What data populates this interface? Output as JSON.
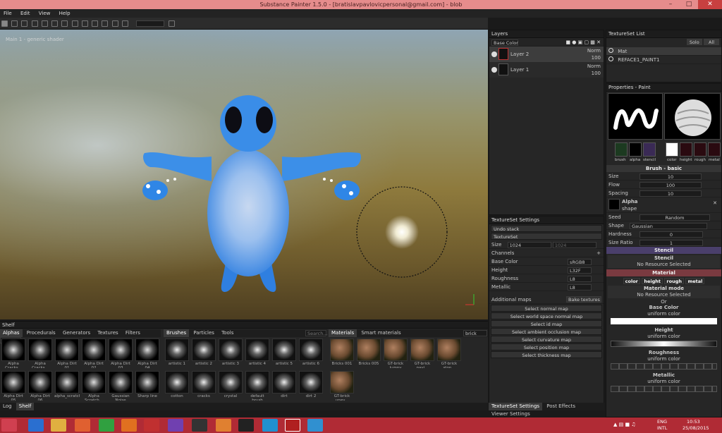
{
  "window": {
    "title": "Substance Painter 1.5.0 - [bratislavpavlovicpersonal@gmail.com] - blob"
  },
  "menu": [
    "File",
    "Edit",
    "View",
    "Help"
  ],
  "viewport": {
    "label": "Main 1 - generic shader"
  },
  "layers": {
    "title": "Layers",
    "channel": "Base Color",
    "items": [
      {
        "name": "Layer 2",
        "blend": "Norm",
        "opacity": "100"
      },
      {
        "name": "Layer 1",
        "blend": "Norm",
        "opacity": "100"
      }
    ]
  },
  "textureset_list": {
    "title": "TextureSet List",
    "solo": "Solo",
    "all": "All",
    "items": [
      "Mat",
      "REFACE1_PAINT1"
    ]
  },
  "properties": {
    "title": "Properties - Paint",
    "slots": [
      "brush",
      "alpha",
      "stencil",
      "color",
      "height",
      "rough",
      "metal"
    ],
    "brush_section": "Brush - basic",
    "size_label": "Size",
    "size_value": "10",
    "flow_label": "Flow",
    "flow_value": "100",
    "spacing_label": "Spacing",
    "spacing_value": "10",
    "alpha_label": "Alpha",
    "alpha_sub": "shape",
    "seed_label": "Seed",
    "seed_value": "Random",
    "shape_label": "Shape",
    "shape_value": "Gaussian",
    "hardness_label": "Hardness",
    "hardness_value": "0",
    "ratio_label": "Size Ratio",
    "ratio_value": "1",
    "stencil_section": "Stencil",
    "stencil_title": "Stencil",
    "stencil_none": "No Resource Selected",
    "material_section": "Material",
    "material_channels": [
      "color",
      "height",
      "rough",
      "metal"
    ],
    "material_mode": "Material mode",
    "material_none": "No Resource Selected",
    "material_or": "Or",
    "basecolor_label": "Base Color",
    "basecolor_sub": "uniform color",
    "height_label": "Height",
    "height_sub": "uniform color",
    "roughness_label": "Roughness",
    "roughness_sub": "uniform color",
    "metallic_label": "Metallic",
    "metallic_sub": "uniform color"
  },
  "textureset_settings": {
    "title": "TextureSet Settings",
    "undo": "Undo stack",
    "textureset": "TextureSet",
    "size_label": "Size",
    "size_value": "1024",
    "size_value2": "1024",
    "channels_label": "Channels",
    "channels": [
      {
        "name": "Base Color",
        "format": "sRGB8"
      },
      {
        "name": "Height",
        "format": "L32F"
      },
      {
        "name": "Roughness",
        "format": "L8"
      },
      {
        "name": "Metallic",
        "format": "L8"
      }
    ],
    "additional_maps": "Additional maps",
    "bake_button": "Bake textures",
    "maps": [
      "Select normal map",
      "Select world space normal map",
      "Select id map",
      "Select ambient occlusion map",
      "Select curvature map",
      "Select position map",
      "Select thickness map"
    ],
    "bottom_tabs": [
      "TextureSet Settings",
      "Post Effects",
      "Viewer Settings"
    ]
  },
  "shelf": {
    "title": "Shelf",
    "tabs": [
      "Alphas",
      "Procedurals",
      "Generators",
      "Textures",
      "Filters"
    ],
    "search_placeholder": "Search...",
    "alphas": [
      "Alpha Cracks...",
      "Alpha Cracks...",
      "Alpha Dirt 01",
      "Alpha Dirt 02",
      "Alpha Dirt 03",
      "Alpha Dirt 04",
      "Alpha Dirt 05",
      "Alpha Dirt 06",
      "alpha_scratch...",
      "Alpha Scratch...",
      "Gaussian Noise",
      "Sharp line"
    ],
    "brush_tabs": [
      "Brushes",
      "Particles",
      "Tools"
    ],
    "brushes": [
      "artistic 1",
      "artistic 2",
      "artistic 3",
      "artistic 4",
      "artistic 5",
      "artistic 6",
      "cotton",
      "cracks",
      "crystal",
      "default brush",
      "dirt",
      "dirt 2"
    ],
    "material_tabs": [
      "Materials",
      "Smart materials"
    ],
    "material_search": "brick",
    "materials": [
      "Bricks 001",
      "Bricks 005",
      "GT-brick lumpy",
      "GT-brick pavi...",
      "GT-brick ston...",
      "GT-brick unev..."
    ],
    "bottom_tabs": [
      "Log",
      "Shelf"
    ]
  },
  "taskbar": {
    "lang": "ENG",
    "region": "INTL",
    "time": "10:53",
    "date": "25/08/2015"
  }
}
